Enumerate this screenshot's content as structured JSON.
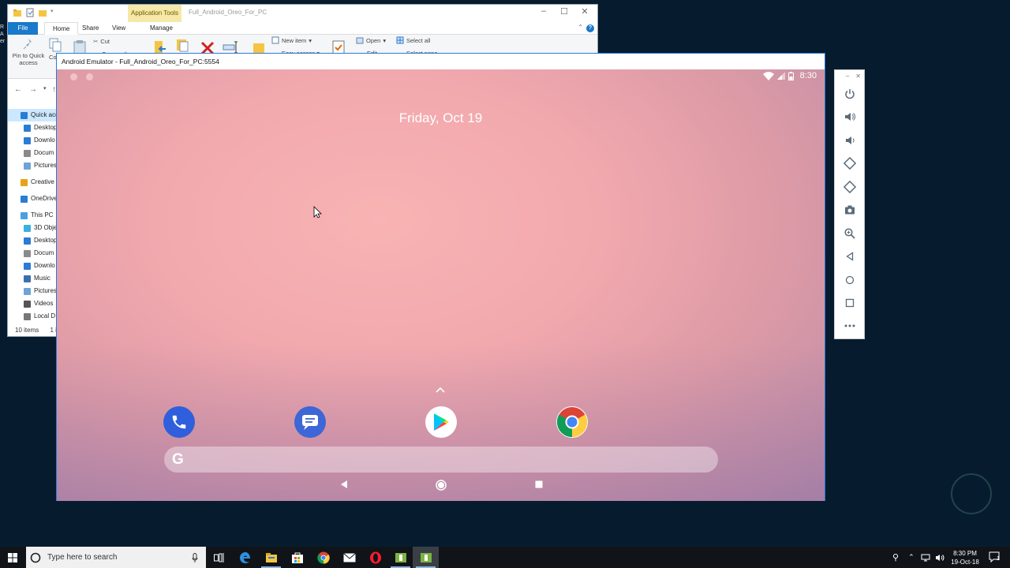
{
  "explorer": {
    "title": "Full_Android_Oreo_For_PC",
    "app_tools_label": "Application Tools",
    "tabs": [
      {
        "label": "File"
      },
      {
        "label": "Home"
      },
      {
        "label": "Share"
      },
      {
        "label": "View"
      },
      {
        "label": "Manage"
      }
    ],
    "ribbon": {
      "pin_label": "Pin to Quick access",
      "copy_label": "Co",
      "cut_label": "Cut",
      "copy_path_label": "Copy path",
      "new_item_label": "New item",
      "easy_access_label": "Easy access",
      "open_label": "Open",
      "edit_label": "Edit",
      "select_all_label": "Select all",
      "select_none_label": "Select none"
    },
    "sidebar": [
      {
        "label": "Quick acc",
        "color": "#2b7cd3",
        "selected": true
      },
      {
        "label": "Desktop",
        "color": "#2b7cd3"
      },
      {
        "label": "Downlo",
        "color": "#2b7cd3"
      },
      {
        "label": "Docum",
        "color": "#8a8a8a"
      },
      {
        "label": "Pictures",
        "color": "#6fa3d6"
      },
      {
        "label": "Creative",
        "color": "#e8a317"
      },
      {
        "label": "OneDrive",
        "color": "#2b7cd3"
      },
      {
        "label": "This PC",
        "color": "#4aa0e0"
      },
      {
        "label": "3D Obje",
        "color": "#3bb0e0"
      },
      {
        "label": "Desktop",
        "color": "#2b7cd3"
      },
      {
        "label": "Docum",
        "color": "#8a8a8a"
      },
      {
        "label": "Downlo",
        "color": "#2b7cd3"
      },
      {
        "label": "Music",
        "color": "#3d6fb0"
      },
      {
        "label": "Pictures",
        "color": "#6fa3d6"
      },
      {
        "label": "Videos",
        "color": "#555"
      },
      {
        "label": "Local D",
        "color": "#777"
      }
    ],
    "status": "10 items",
    "status_extra": "1 it",
    "left_strip": "R\nA\ner"
  },
  "emulator": {
    "title": "Android Emulator - Full_Android_Oreo_For_PC:5554",
    "time": "8:30",
    "date": "Friday, Oct 19",
    "dock_apps": [
      {
        "name": "Phone",
        "icon": "phone-icon",
        "color": "#2f5fdd"
      },
      {
        "name": "Messages",
        "icon": "messages-icon",
        "color": "#3d66d6"
      },
      {
        "name": "Play Store",
        "icon": "play-store-icon",
        "color": "#ffffff"
      },
      {
        "name": "Chrome",
        "icon": "chrome-icon",
        "color": "#ffffff"
      }
    ],
    "search_logo": "G"
  },
  "toolbar": {
    "buttons": [
      "power-icon",
      "volume-up-icon",
      "volume-down-icon",
      "rotate-left-icon",
      "rotate-right-icon",
      "screenshot-icon",
      "zoom-icon",
      "back-icon",
      "home-icon",
      "overview-icon",
      "more-icon"
    ]
  },
  "taskbar": {
    "search_placeholder": "Type here to search",
    "time": "8:30 PM",
    "date": "19-Oct-18",
    "notification_count": "1"
  }
}
